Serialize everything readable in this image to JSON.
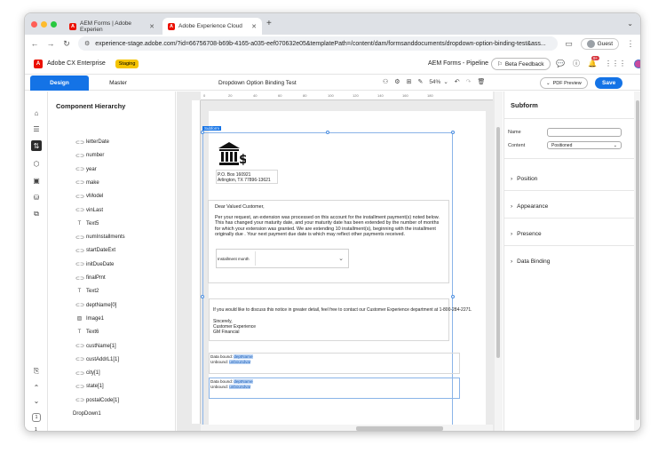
{
  "browser": {
    "tabs": [
      {
        "label": "AEM Forms | Adobe Experien",
        "active": false
      },
      {
        "label": "Adobe Experience Cloud",
        "active": true
      }
    ],
    "url": "experience-stage.adobe.com/?id=66756708-b69b-4165-a035-eef070632e05&templatePath=/content/dam/formsanddocuments/dropdown-option-binding-test&ass...",
    "profile_label": "Guest"
  },
  "app_header": {
    "brand": "Adobe CX Enterprise",
    "env_badge": "Staging",
    "app_name": "AEM Forms - Pipeline",
    "beta_label": "Beta Feedback",
    "notification_count": "9+"
  },
  "toolbar": {
    "mode_design": "Design",
    "mode_master": "Master",
    "document_title": "Dropdown Option Binding Test",
    "zoom": "54%",
    "pdf_preview": "PDF Preview",
    "save": "Save"
  },
  "hierarchy": {
    "title": "Component Hierarchy",
    "items": [
      {
        "label": "letterDate",
        "icon": "field-icon"
      },
      {
        "label": "number",
        "icon": "field-icon"
      },
      {
        "label": "year",
        "icon": "field-icon"
      },
      {
        "label": "make",
        "icon": "field-icon"
      },
      {
        "label": "vModel",
        "icon": "field-icon"
      },
      {
        "label": "vinLast",
        "icon": "field-icon"
      },
      {
        "label": "Text5",
        "icon": "text-icon"
      },
      {
        "label": "numInstallments",
        "icon": "field-icon"
      },
      {
        "label": "startDateExt",
        "icon": "field-icon"
      },
      {
        "label": "initDueDate",
        "icon": "field-icon"
      },
      {
        "label": "finalPmt",
        "icon": "field-icon"
      },
      {
        "label": "Text2",
        "icon": "text-icon"
      },
      {
        "label": "deptName[0]",
        "icon": "field-icon"
      },
      {
        "label": "Image1",
        "icon": "image-icon"
      },
      {
        "label": "Text6",
        "icon": "text-icon"
      },
      {
        "label": "custName[1]",
        "icon": "field-icon"
      },
      {
        "label": "custAddrL1[1]",
        "icon": "field-icon"
      },
      {
        "label": "city[1]",
        "icon": "field-icon"
      },
      {
        "label": "state[1]",
        "icon": "field-icon"
      },
      {
        "label": "postalCode[1]",
        "icon": "field-icon"
      },
      {
        "label": "DropDown1",
        "icon": "none"
      }
    ]
  },
  "rail": {
    "page_current": "1",
    "page_total": "1"
  },
  "ruler": {
    "ticks": [
      "0",
      "20",
      "40",
      "60",
      "80",
      "100",
      "120",
      "140",
      "160",
      "180"
    ]
  },
  "form": {
    "subform_tag": "Subform",
    "address_line1": "P.O. Box 160921",
    "address_line2": "Arlington, TX 77896-13621",
    "greeting": "Dear Valued Customer,",
    "paragraph": "Per your request, an extension was processed on this account for the installment payment(s) noted below. This has changed your maturity date, and your maturity date has been extended by the number of months for which your extension was granted. We are extending 10 installment(s), beginning with the installment originally due . Your next payment due date is  which may reflect other payments received.",
    "installment_label": "Installment month",
    "contact_line": "If you would like to discuss this notice in greater detail, feel free to contact our Customer Experience department at 1-800-284-2271.",
    "closing": "Sincerely,",
    "sign_dept": "Customer Experience",
    "sign_company": "GM Financial",
    "bind1_label": "Data bound: ",
    "bind1_value": "deptName",
    "unbound1_label": "Unbound: ",
    "unbound1_value": "unboundvar",
    "bind2_label": "Data bound: ",
    "bind2_value": "deptName",
    "unbound2_label": "Unbound: ",
    "unbound2_value": "unboundvar"
  },
  "properties": {
    "title": "Subform",
    "name_label": "Name",
    "name_value": "",
    "content_label": "Content",
    "content_value": "Positioned",
    "sections": [
      "Position",
      "Appearance",
      "Presence",
      "Data Binding"
    ]
  },
  "colors": {
    "accent": "#1473e6",
    "staging_badge": "#f5c400",
    "adobe_red": "#eb1000"
  }
}
